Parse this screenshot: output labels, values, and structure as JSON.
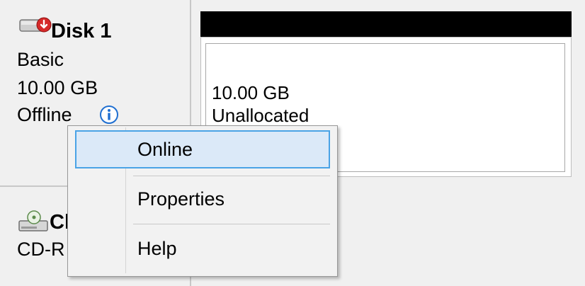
{
  "disk": {
    "title": "Disk 1",
    "type": "Basic",
    "size": "10.00 GB",
    "status": "Offline"
  },
  "partition": {
    "size": "10.00 GB",
    "status": "Unallocated"
  },
  "cdrom": {
    "title_visible": "Cl",
    "type_visible": "CD-R"
  },
  "context_menu": {
    "items": [
      {
        "label": "Online",
        "highlighted": true
      },
      {
        "label": "Properties",
        "highlighted": false
      },
      {
        "label": "Help",
        "highlighted": false
      }
    ]
  },
  "colors": {
    "highlight_fill": "#dbe9f8",
    "highlight_border": "#4aa3e6",
    "partition_header": "#000000",
    "info_icon": "#1f6fd1",
    "offline_icon": "#d62a2a"
  },
  "icons": {
    "disk": "disk-offline-icon",
    "info": "info-icon",
    "cdrom": "cdrom-drive-icon"
  }
}
